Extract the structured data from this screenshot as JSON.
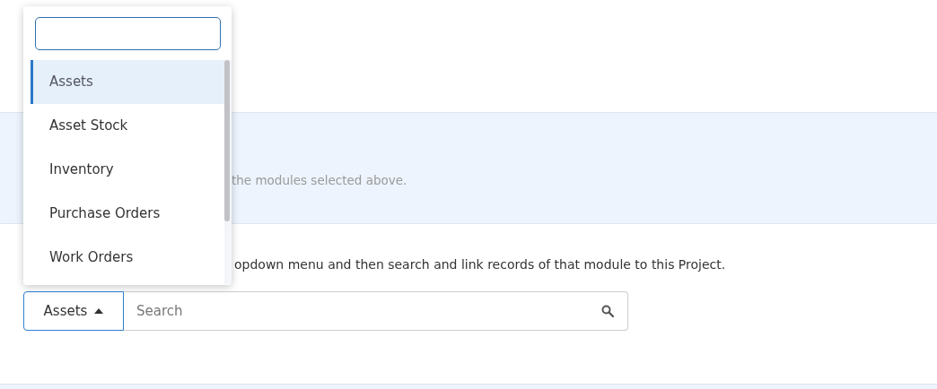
{
  "info_band": {
    "text": "the modules selected above."
  },
  "instructions": {
    "text": "opdown menu and then search and link records of that module to this Project."
  },
  "module_button": {
    "label": "Assets",
    "open": true
  },
  "search": {
    "placeholder": "Search"
  },
  "module_dropdown": {
    "open": true,
    "items": [
      {
        "label": "Assets",
        "selected": true
      },
      {
        "label": "Asset Stock",
        "selected": false
      },
      {
        "label": "Inventory",
        "selected": false
      },
      {
        "label": "Purchase Orders",
        "selected": false
      },
      {
        "label": "Work Orders",
        "selected": false
      }
    ]
  }
}
